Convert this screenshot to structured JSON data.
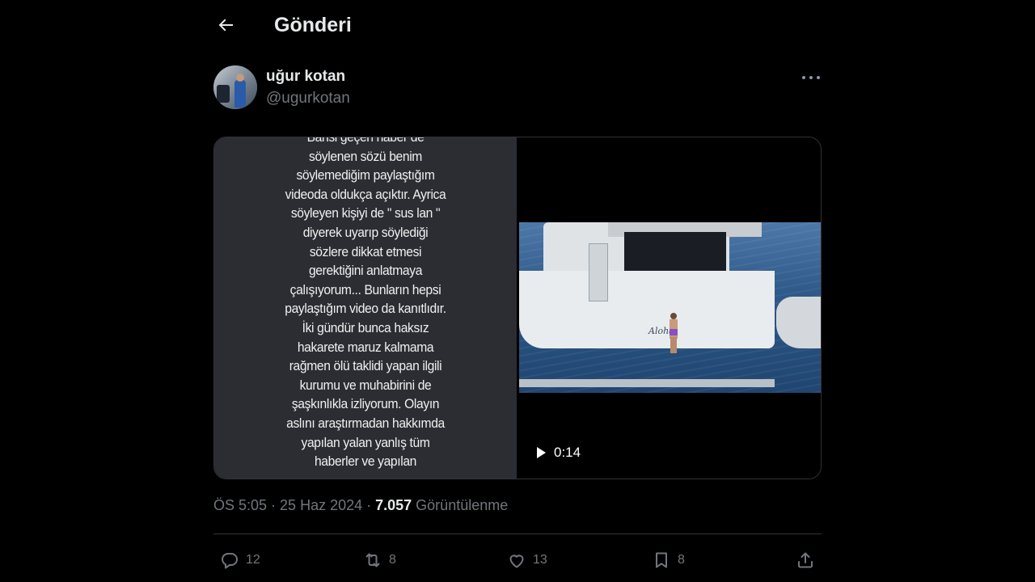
{
  "header": {
    "title": "Gönderi"
  },
  "author": {
    "display_name": "uğur kotan",
    "handle": "@ugurkotan"
  },
  "media": {
    "story_lines": [
      "Bahsi geçen haber de",
      "söylenen sözü benim",
      "söylemediğim paylaştığım",
      "videoda oldukça açıktır.  Ayrica",
      "söyleyen kişiyi de \" sus lan \"",
      "diyerek uyarıp söylediği",
      "sözlere dikkat etmesi",
      "gerektiğini anlatmaya",
      "çalışıyorum... Bunların hepsi",
      "paylaştığım video da kanıtlıdır.",
      "İki gündür bunca haksız",
      "hakarete maruz kalmama",
      "rağmen  ölü taklidi yapan ilgili",
      "kurumu ve muhabirini de",
      "şaşkınlıkla izliyorum. Olayın",
      "aslını araştırmadan hakkımda",
      "yapılan yalan yanlış tüm",
      "haberler ve yapılan"
    ],
    "boat_name": "Aloha",
    "video_duration": "0:14"
  },
  "meta": {
    "time": "ÖS 5:05",
    "date": "25 Haz 2024",
    "separator": "·",
    "views_count": "7.057",
    "views_label": "Görüntülenme"
  },
  "actions": {
    "replies": "12",
    "reposts": "8",
    "likes": "13",
    "bookmarks": "8"
  },
  "icons": [
    "back-arrow-icon",
    "more-icon",
    "play-icon",
    "reply-icon",
    "repost-icon",
    "like-icon",
    "bookmark-icon",
    "share-icon"
  ],
  "colors": {
    "background": "#000000",
    "text": "#e7e9ea",
    "muted": "#71767b",
    "divider": "#2f3336"
  }
}
